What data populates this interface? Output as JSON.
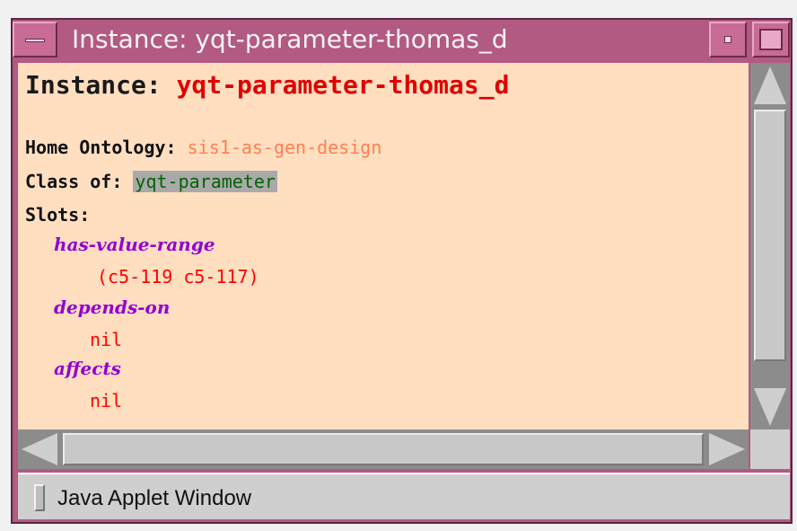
{
  "window": {
    "title": "Instance: yqt-parameter-thomas_d"
  },
  "instance": {
    "label": "Instance: ",
    "name": "yqt-parameter-thomas_d"
  },
  "home_ontology": {
    "label": "Home Ontology: ",
    "value": "sis1-as-gen-design"
  },
  "class_of": {
    "label": "Class of: ",
    "value": "yqt-parameter"
  },
  "slots": {
    "label": "Slots:",
    "items": [
      {
        "name": "has-value-range",
        "value": "(c5-119 c5-117)"
      },
      {
        "name": "depends-on",
        "value": "nil"
      },
      {
        "name": "affects",
        "value": "nil"
      }
    ]
  },
  "statusbar": {
    "text": "Java Applet Window"
  }
}
